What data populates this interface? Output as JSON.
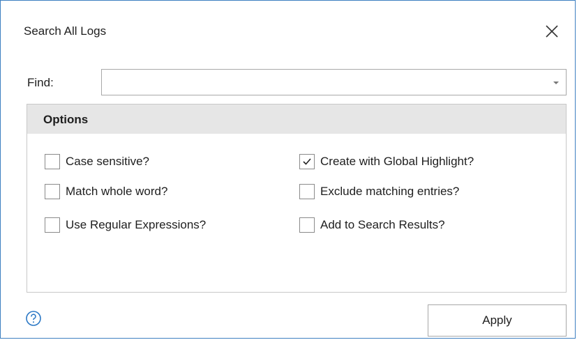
{
  "dialog": {
    "title": "Search All Logs",
    "close_icon": "close-icon",
    "accent_color": "#3c7fc1"
  },
  "find": {
    "label": "Find:",
    "value": "",
    "placeholder": "",
    "dropdown_icon": "chevron-down-icon"
  },
  "options": {
    "title": "Options",
    "header_color": "#e6e6e6",
    "items": [
      {
        "label": "Case sensitive?",
        "checked": false
      },
      {
        "label": "Match whole word?",
        "checked": false
      },
      {
        "label": "Use Regular Expressions?",
        "checked": false
      },
      {
        "label": "Create with Global Highlight?",
        "checked": true
      },
      {
        "label": "Exclude matching entries?",
        "checked": false
      },
      {
        "label": "Add to Search Results?",
        "checked": false
      }
    ]
  },
  "footer": {
    "help_icon": "help-icon",
    "apply_label": "Apply"
  }
}
